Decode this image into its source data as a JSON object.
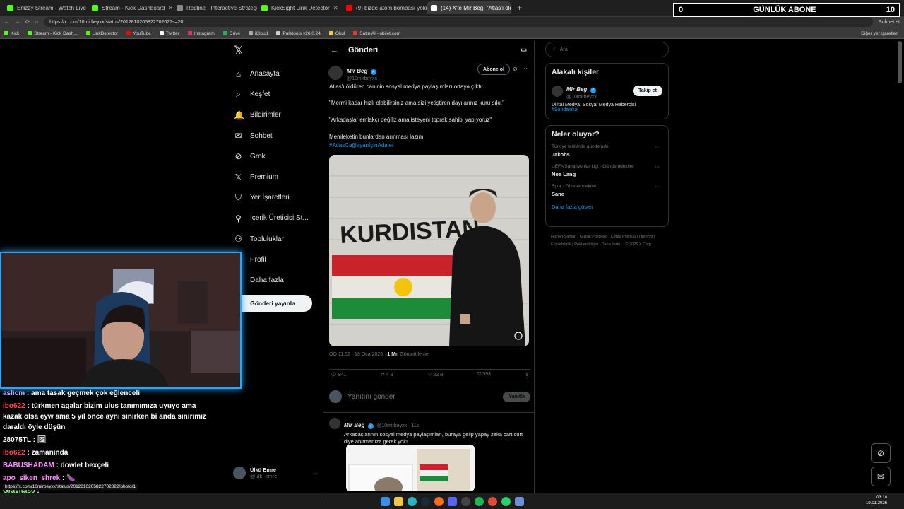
{
  "browser": {
    "tabs": [
      {
        "title": "Erlizzy Stream - Watch Live on Kick",
        "color": "#53fc18"
      },
      {
        "title": "Stream - Kick Dashboard",
        "color": "#53fc18"
      },
      {
        "title": "Redline - Interactive Strategic Map",
        "color": "#888888"
      },
      {
        "title": "KickSight Link Detector",
        "color": "#53fc18"
      },
      {
        "title": "(9) bizde atom bombası yokmu lk...",
        "color": "#ff0000"
      },
      {
        "title": "(14) X'te Mîr Beg: \"Atlas'ı öldürü...",
        "color": "#ffffff"
      }
    ],
    "url": "https://x.com/10mirbeyxx/status/2012810205822702027s=20",
    "bookmarks": [
      "Kick",
      "Stream - Kick Dash...",
      "LinkDetector",
      "YouTube",
      "Twitter",
      "Instagram",
      "Drive",
      "iCloud",
      "Paletools v26.0.24",
      "Okul",
      "Satın Al - obilet.com"
    ],
    "other_bookmarks": "Diğer yer işaretleri",
    "chat_label": "Sohbet et"
  },
  "overlay": {
    "left": "0",
    "label": "GÜNLÜK ABONE",
    "right": "10"
  },
  "nav": {
    "items": [
      {
        "label": "Anasayfa",
        "icon": "⌂",
        "name": "home"
      },
      {
        "label": "Keşfet",
        "icon": "⌕",
        "name": "explore"
      },
      {
        "label": "Bildirimler",
        "icon": "🔔",
        "name": "notifications"
      },
      {
        "label": "Sohbet",
        "icon": "✉",
        "name": "chat"
      },
      {
        "label": "Grok",
        "icon": "⊘",
        "name": "grok"
      },
      {
        "label": "Premium",
        "icon": "𝕏",
        "name": "premium"
      },
      {
        "label": "Yer İşaretleri",
        "icon": "⛉",
        "name": "bookmarks"
      },
      {
        "label": "İçerik Üreticisi St...",
        "icon": "⚲",
        "name": "creator-studio"
      },
      {
        "label": "Topluluklar",
        "icon": "⚇",
        "name": "communities"
      },
      {
        "label": "Profil",
        "icon": "☺",
        "name": "profile"
      },
      {
        "label": "Daha fazla",
        "icon": "⋯",
        "name": "more"
      }
    ],
    "post_button": "Gönderi yayınla",
    "account_name": "Ülkü Emre",
    "account_handle": "@ulk_emre"
  },
  "main": {
    "header": "Gönderi",
    "tweet": {
      "author": "Mîr Beg",
      "handle": "@10mirbeyxx",
      "subscribe": "Abone ol",
      "lines": [
        "Atlas'ı öldüren caninin sosyal medya paylaşımları ortaya çıktı:",
        "\"Mermi kadar hızlı olabilirsiniz ama sizi yetiştiren dayılarınız kuru sıkı.\"",
        "\"Arkadaşlar emlakçı değiliz ama isteyeni toprak sahibi yapıyoruz\"",
        "Memleketin bunlardan arınması lazım"
      ],
      "hashtag": "#AtlasÇağlayanİçinAdalet",
      "image_text": "KURDISTAN",
      "time": "ÖÖ 11:52 · 18 Oca 2026 · ",
      "views": "1 Mn",
      "views_label": " Görüntüleme",
      "replies": "841",
      "retweets": "4 B",
      "likes": "22 B",
      "bookmarks": "593"
    },
    "reply_placeholder": "Yanıtını gönder",
    "reply_button": "Yanıtla",
    "tweet2": {
      "author": "Mîr Beg",
      "handle": "@10mirbeyxx · 11s",
      "text": "Arkadaşlarının sosyal medya paylaşımları, buraya gelip yapay zeka cart curt diye anırmanıza gerek yok!"
    }
  },
  "right": {
    "search_placeholder": "Ara",
    "related_title": "Alakalı kişiler",
    "related": {
      "name": "Mîr Beg",
      "handle": "@10mirbeyxx",
      "follow": "Takip et",
      "bio": "Dijital Medya, Sosyal Medya Habercisi",
      "bio_tag": "#Sondakika"
    },
    "trends_title": "Neler oluyor?",
    "trends": [
      {
        "context": "Türkiye tarihinde gündemde",
        "name": "Jakobs"
      },
      {
        "context": "UEFA Şampiyonlar Ligi · Gündemdekiler",
        "name": "Noa Lang"
      },
      {
        "context": "Spor · Gündemdekiler",
        "name": "Sane"
      }
    ],
    "show_more": "Daha fazla göster",
    "footer": "Hizmet Şartları | Gizlilik Politikası | Çerez Politikası | Imprint | Erişilebilirlik | Reklam bilgisi | Daha fazla ... © 2026 X Corp."
  },
  "chat": [
    {
      "user": "aslicm",
      "color": "#c9a0ff",
      "text": "ama tasak geçmek çok eğlenceli"
    },
    {
      "user": "ibo622",
      "color": "#ff4d4d",
      "text": "türkmen agalar bizim ulus tanımımıza uyuyo ama kazak olsa eyw ama 5 yıl önce aynı sınırken bi anda sınırımız daraldı öyle düşün"
    },
    {
      "user": "28075TL",
      "color": "#ffffff",
      "text": "🖼"
    },
    {
      "user": "ibo622",
      "color": "#ff4d4d",
      "text": "zamanında"
    },
    {
      "user": "BABUSHADAM",
      "color": "#ff8cff",
      "text": "dowlet bexçeli"
    },
    {
      "user": "apo_siken_shrek",
      "color": "#ff8cff",
      "text": "🍆"
    },
    {
      "user": "Gravitas0",
      "color": "#7fff7f",
      "text": ""
    }
  ],
  "status_url": "https://x.com/10mirbeyxx/status/2012810205822702022/photo/1",
  "clock": {
    "time": "03:18",
    "date": "19.01.2026"
  }
}
